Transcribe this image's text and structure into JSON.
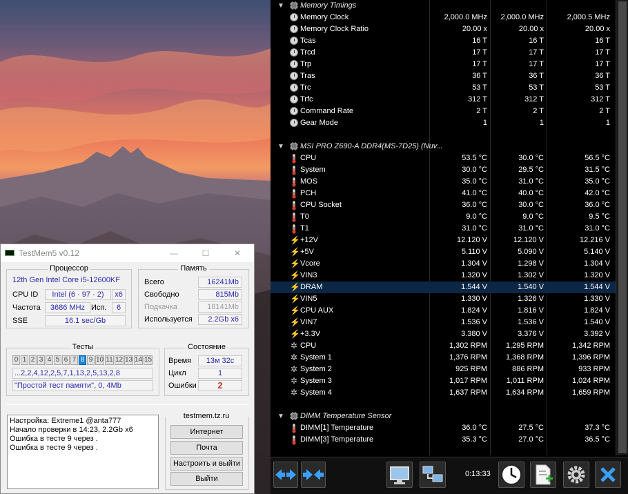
{
  "testmem": {
    "title": "TestMem5 v0.12",
    "window_controls": [
      "—",
      "☐",
      "✕"
    ],
    "cpu": {
      "title": "Процессор",
      "model": "12th Gen Intel Core i5-12600KF",
      "cpuid_label": "CPU ID",
      "cpuid_value": "Intel  (6 · 97 · 2)",
      "threads": "x6",
      "freq_label": "Частота",
      "freq_value": "3686 MHz",
      "used_label": "Исп.",
      "used_value": "6",
      "sse_label": "SSE",
      "sse_value": "16.1 sec/Gb"
    },
    "memory": {
      "title": "Память",
      "total_label": "Всего",
      "total_value": "16241Mb",
      "free_label": "Свободно",
      "free_value": "815Mb",
      "swap_label": "Подкачка",
      "swap_value": "18141Mb",
      "used_label": "Используется",
      "used_value": "2.2Gb x6"
    },
    "tests": {
      "title": "Тесты",
      "numbers": [
        "0",
        "1",
        "2",
        "3",
        "4",
        "5",
        "6",
        "7",
        "8",
        "9",
        "10",
        "11",
        "12",
        "13",
        "14",
        "15"
      ],
      "active": "8",
      "sequence": "...2,2,4,12,2,5,7,1,13,2,5,13,2,8",
      "current": "\"Простой тест памяти\", 0, 4Mb"
    },
    "status": {
      "title": "Состояние",
      "time_label": "Время",
      "time_value": "13м 32с",
      "cycle_label": "Цикл",
      "cycle_value": "1",
      "errors_label": "Ошибки",
      "errors_value": "2"
    },
    "log": [
      "Настройка: Extreme1 @anta777",
      "Начало проверки в 14:23, 2.2Gb x6",
      "Ошибка в тесте 9 через .",
      "Ошибка в тесте 9 через ."
    ],
    "site": "testmem.tz.ru",
    "buttons": {
      "internet": "Интернет",
      "mail": "Почта",
      "config_exit": "Настроить и выйти",
      "exit": "Выйти"
    }
  },
  "hwinfo": {
    "rows": [
      {
        "type": "header",
        "name": "Memory Timings",
        "expander": "▼",
        "icon": "chip"
      },
      {
        "type": "clock",
        "name": "Memory Clock",
        "v": [
          "2,000.0 MHz",
          "2,000.0 MHz",
          "2,000.5 MHz"
        ]
      },
      {
        "type": "clock",
        "name": "Memory Clock Ratio",
        "v": [
          "20.00 x",
          "20.00 x",
          "20.00 x"
        ]
      },
      {
        "type": "clock",
        "name": "Tcas",
        "v": [
          "16 T",
          "16 T",
          "16 T"
        ]
      },
      {
        "type": "clock",
        "name": "Trcd",
        "v": [
          "17 T",
          "17 T",
          "17 T"
        ]
      },
      {
        "type": "clock",
        "name": "Trp",
        "v": [
          "17 T",
          "17 T",
          "17 T"
        ]
      },
      {
        "type": "clock",
        "name": "Tras",
        "v": [
          "36 T",
          "36 T",
          "36 T"
        ]
      },
      {
        "type": "clock",
        "name": "Trc",
        "v": [
          "53 T",
          "53 T",
          "53 T"
        ]
      },
      {
        "type": "clock",
        "name": "Trfc",
        "v": [
          "312 T",
          "312 T",
          "312 T"
        ]
      },
      {
        "type": "clock",
        "name": "Command Rate",
        "v": [
          "2 T",
          "2 T",
          "2 T"
        ]
      },
      {
        "type": "clock",
        "name": "Gear Mode",
        "v": [
          "1",
          "1",
          "1"
        ]
      },
      {
        "type": "blank"
      },
      {
        "type": "header",
        "name": "MSI PRO Z690-A DDR4(MS-7D25) (Nuv...",
        "expander": "▼",
        "icon": "chip"
      },
      {
        "type": "temp",
        "name": "CPU",
        "v": [
          "53.5 °C",
          "30.0 °C",
          "56.5 °C"
        ]
      },
      {
        "type": "temp",
        "name": "System",
        "v": [
          "30.0 °C",
          "29.5 °C",
          "31.5 °C"
        ]
      },
      {
        "type": "temp",
        "name": "MOS",
        "v": [
          "35.0 °C",
          "31.0 °C",
          "35.0 °C"
        ]
      },
      {
        "type": "temp",
        "name": "PCH",
        "v": [
          "41.0 °C",
          "40.0 °C",
          "42.0 °C"
        ]
      },
      {
        "type": "temp",
        "name": "CPU Socket",
        "v": [
          "36.0 °C",
          "30.0 °C",
          "36.0 °C"
        ]
      },
      {
        "type": "temp",
        "name": "T0",
        "v": [
          "9.0 °C",
          "9.0 °C",
          "9.5 °C"
        ]
      },
      {
        "type": "temp",
        "name": "T1",
        "v": [
          "31.0 °C",
          "31.0 °C",
          "31.0 °C"
        ]
      },
      {
        "type": "volt",
        "name": "+12V",
        "v": [
          "12.120 V",
          "12.120 V",
          "12.216 V"
        ]
      },
      {
        "type": "volt",
        "name": "+5V",
        "v": [
          "5.110 V",
          "5.090 V",
          "5.140 V"
        ]
      },
      {
        "type": "volt",
        "name": "Vcore",
        "v": [
          "1.304 V",
          "1.298 V",
          "1.304 V"
        ]
      },
      {
        "type": "volt",
        "name": "VIN3",
        "v": [
          "1.320 V",
          "1.302 V",
          "1.320 V"
        ]
      },
      {
        "type": "volt",
        "name": "DRAM",
        "v": [
          "1.544 V",
          "1.540 V",
          "1.544 V"
        ],
        "selected": true
      },
      {
        "type": "volt",
        "name": "VIN5",
        "v": [
          "1.330 V",
          "1.326 V",
          "1.330 V"
        ]
      },
      {
        "type": "volt",
        "name": "CPU AUX",
        "v": [
          "1.824 V",
          "1.816 V",
          "1.824 V"
        ]
      },
      {
        "type": "volt",
        "name": "VIN7",
        "v": [
          "1.536 V",
          "1.536 V",
          "1.540 V"
        ]
      },
      {
        "type": "volt",
        "name": "+3.3V",
        "v": [
          "3.380 V",
          "3.376 V",
          "3.392 V"
        ]
      },
      {
        "type": "fan",
        "name": "CPU",
        "v": [
          "1,302 RPM",
          "1,295 RPM",
          "1,342 RPM"
        ]
      },
      {
        "type": "fan",
        "name": "System 1",
        "v": [
          "1,376 RPM",
          "1,368 RPM",
          "1,396 RPM"
        ]
      },
      {
        "type": "fan",
        "name": "System 2",
        "v": [
          "925 RPM",
          "886 RPM",
          "933 RPM"
        ]
      },
      {
        "type": "fan",
        "name": "System 3",
        "v": [
          "1,017 RPM",
          "1,011 RPM",
          "1,024 RPM"
        ]
      },
      {
        "type": "fan",
        "name": "System 4",
        "v": [
          "1,637 RPM",
          "1,634 RPM",
          "1,659 RPM"
        ]
      },
      {
        "type": "blank"
      },
      {
        "type": "header",
        "name": "DIMM Temperature Sensor",
        "expander": "▼",
        "icon": "chip"
      },
      {
        "type": "temp",
        "name": "DIMM[1] Temperature",
        "v": [
          "36.0 °C",
          "27.5 °C",
          "37.3 °C"
        ]
      },
      {
        "type": "temp",
        "name": "DIMM[3] Temperature",
        "v": [
          "35.3 °C",
          "27.0 °C",
          "36.5 °C"
        ]
      }
    ],
    "toolbar": {
      "elapsed": "0:13:33",
      "icons": [
        "expand-arrows-icon",
        "collapse-arrows-icon",
        "monitor-icon",
        "network-icon",
        "clock-icon",
        "add-report-icon",
        "settings-gear-icon",
        "close-x-icon"
      ]
    },
    "colors": {
      "selected_row": "#0c2746",
      "volt_icon": "#f5c400",
      "active_test": "#1b86d8",
      "error_count": "#c0392b"
    }
  }
}
